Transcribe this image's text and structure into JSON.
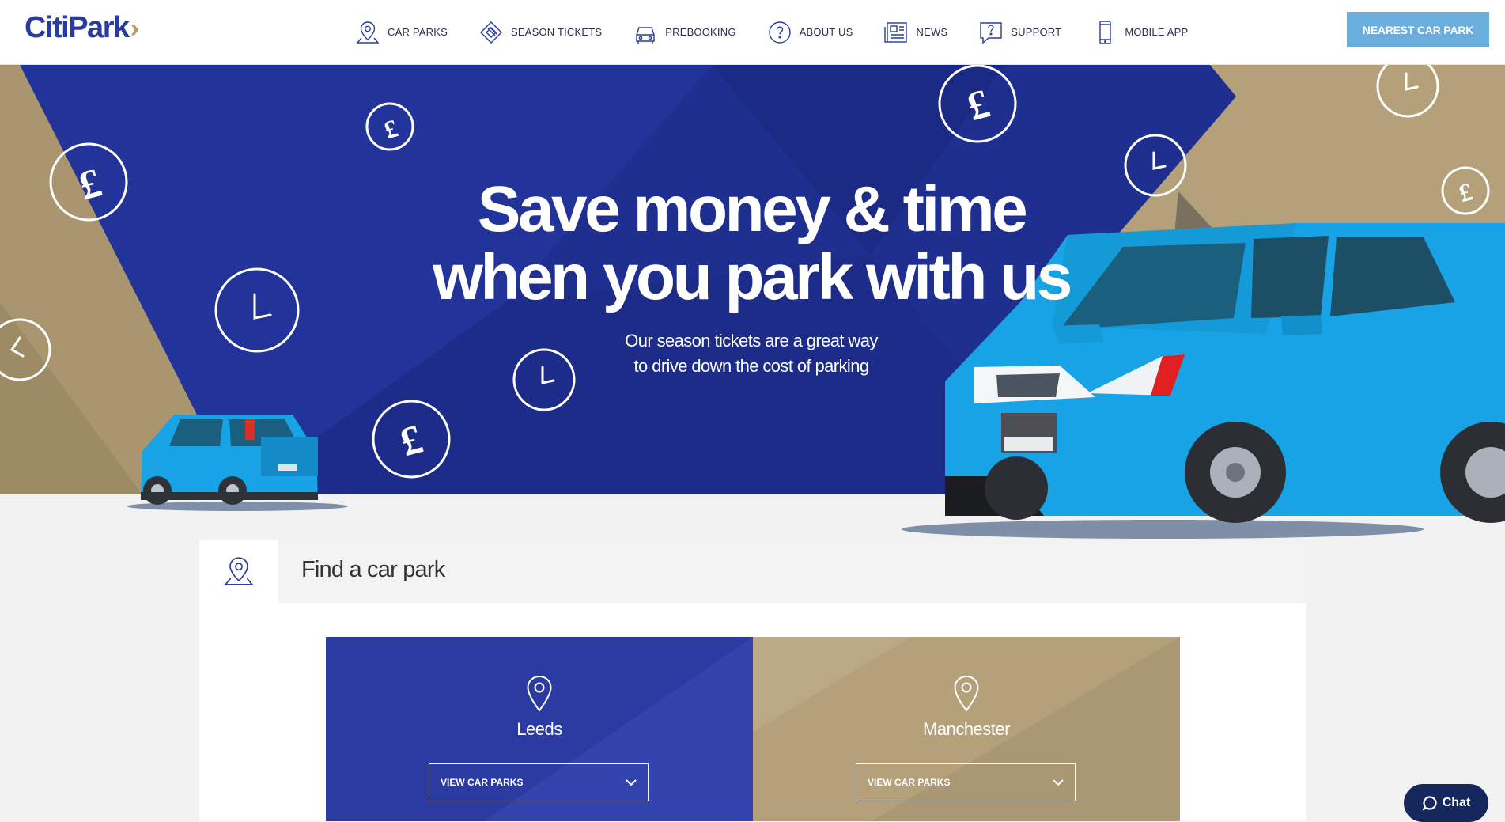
{
  "brand": {
    "name": "CitiPark",
    "chevron": "›"
  },
  "nav": [
    {
      "label": "CAR PARKS",
      "icon": "map-pin-icon"
    },
    {
      "label": "SEASON TICKETS",
      "icon": "ticket-icon"
    },
    {
      "label": "PREBOOKING",
      "icon": "car-icon"
    },
    {
      "label": "ABOUT US",
      "icon": "question-icon"
    },
    {
      "label": "NEWS",
      "icon": "newspaper-icon"
    },
    {
      "label": "SUPPORT",
      "icon": "support-icon"
    },
    {
      "label": "MOBILE APP",
      "icon": "phone-icon"
    }
  ],
  "cta": {
    "label": "NEAREST CAR PARK"
  },
  "hero": {
    "title_line1": "Save money & time",
    "title_line2": "when you park with us",
    "subtitle_line1": "Our season tickets are a great way",
    "subtitle_line2": "to drive down the cost of parking"
  },
  "find": {
    "title": "Find a car park",
    "cities": [
      {
        "name": "Leeds",
        "select_label": "VIEW CAR PARKS"
      },
      {
        "name": "Manchester",
        "select_label": "VIEW CAR PARKS"
      }
    ]
  },
  "chat": {
    "label": "Chat"
  },
  "colors": {
    "brand_blue": "#2a3ba0",
    "hero_blue": "#1e2f8f",
    "tan": "#b4a079",
    "cta": "#6aaedd",
    "car_blue": "#18a3e6",
    "chat_bg": "#14285d"
  }
}
